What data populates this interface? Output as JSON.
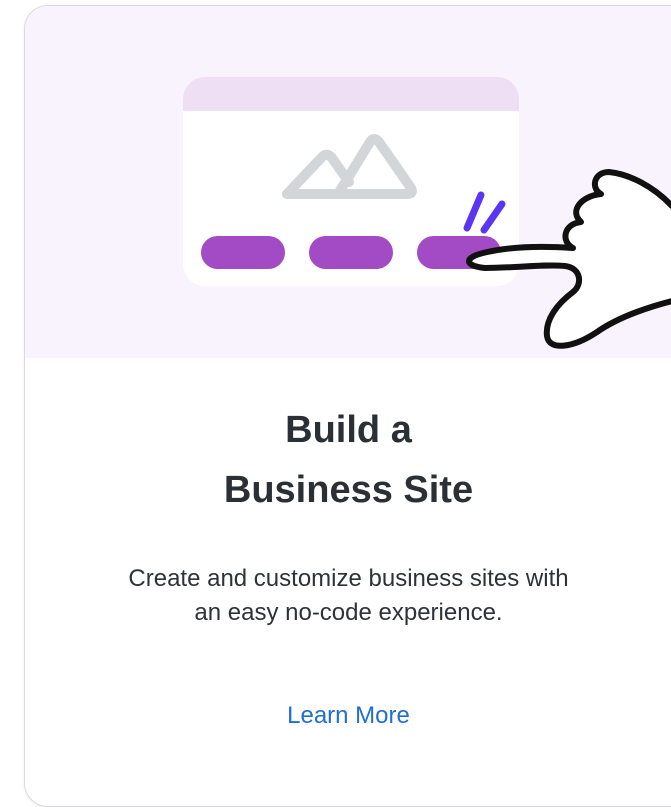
{
  "card": {
    "title_line1": "Build a",
    "title_line2": "Business Site",
    "description_line1": "Create and customize business sites with",
    "description_line2": "an easy no-code experience.",
    "link_label": "Learn More"
  },
  "illustration": {
    "icons": [
      "browser-window-icon",
      "image-placeholder-icon",
      "pointing-hand-icon",
      "click-spark-icon"
    ]
  },
  "colors": {
    "hero_background": "#f8f3fc",
    "window_header": "#efdff4",
    "pill_purple": "#a34bc5",
    "spark_blue": "#5b36f2",
    "link_blue": "#1f6fd1",
    "title_text": "#2b2f36"
  }
}
